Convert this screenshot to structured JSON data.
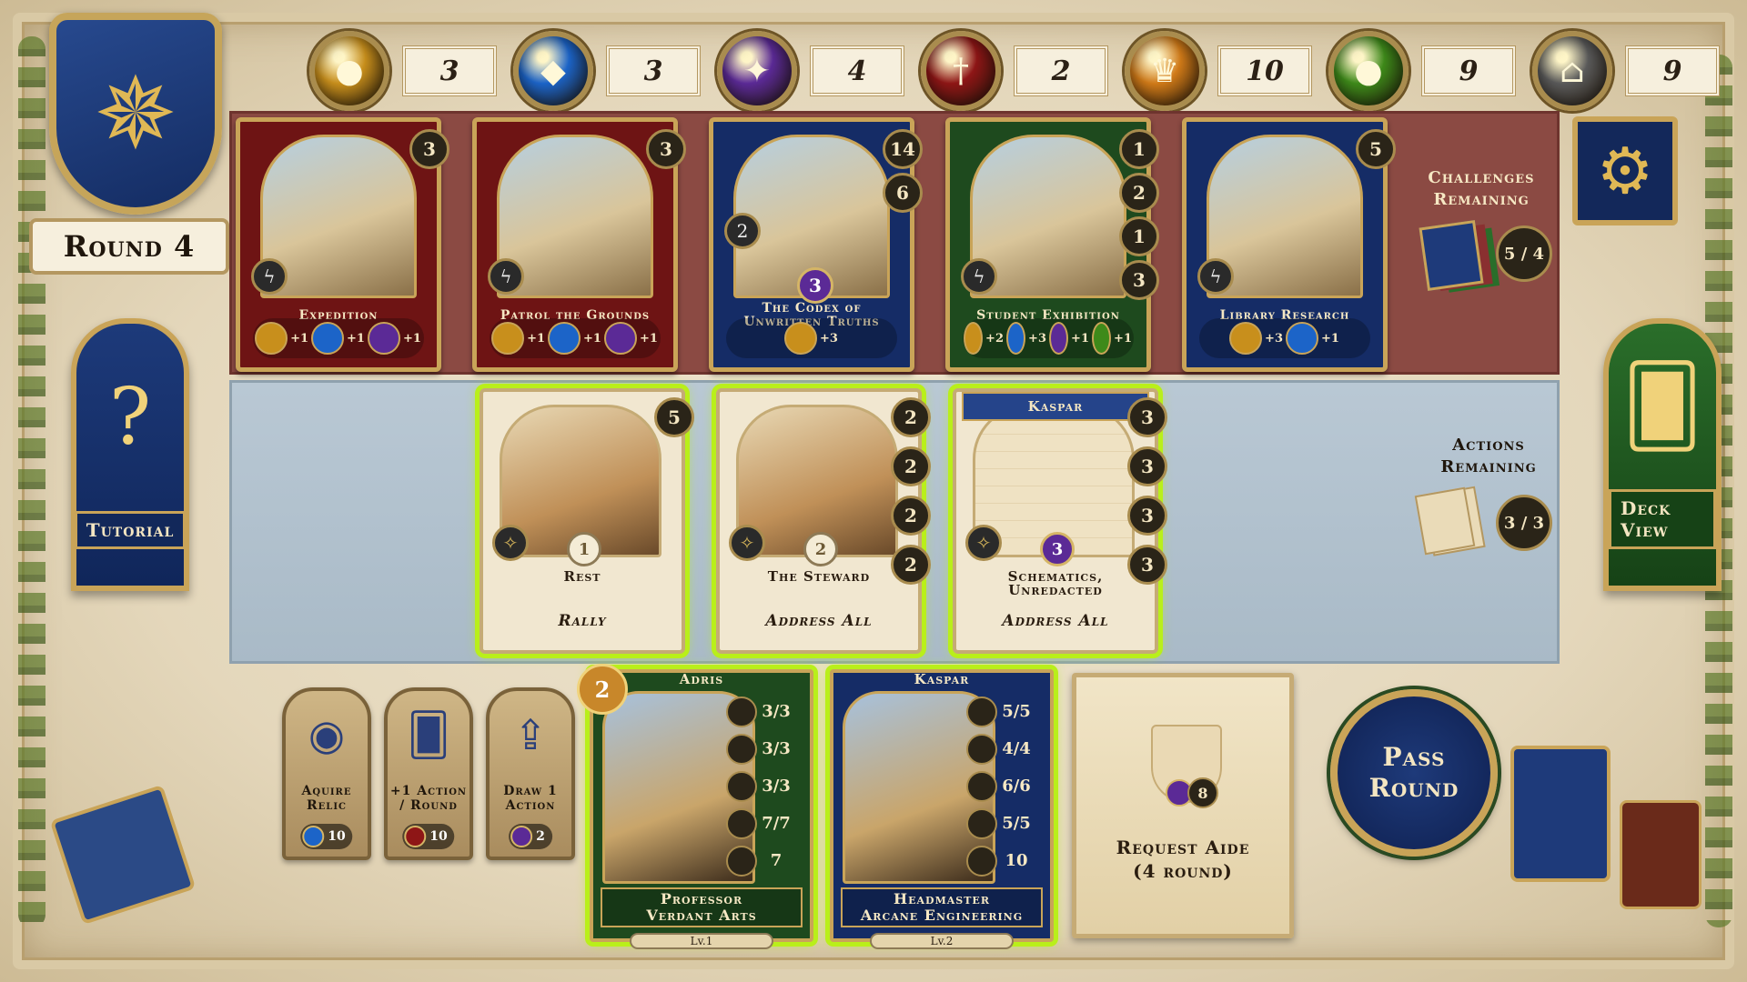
{
  "resources": [
    {
      "icon": "gold-cluster-icon",
      "glyph": "●",
      "color": "#c88f1c",
      "value": "3"
    },
    {
      "icon": "blue-crystal-icon",
      "glyph": "◆",
      "color": "#1c64c8",
      "value": "3"
    },
    {
      "icon": "purple-star-icon",
      "glyph": "✦",
      "color": "#5b2a96",
      "value": "4"
    },
    {
      "icon": "red-sword-icon",
      "glyph": "†",
      "color": "#8e1616",
      "value": "2"
    },
    {
      "icon": "crown-icon",
      "glyph": "♛",
      "color": "#d07a18",
      "value": "10"
    },
    {
      "icon": "green-cluster-icon",
      "glyph": "●",
      "color": "#3e8a1a",
      "value": "9"
    },
    {
      "icon": "building-icon",
      "glyph": "⌂",
      "color": "#5a5a5a",
      "value": "9"
    }
  ],
  "round_label": "Round 4",
  "banners": {
    "tutorial": "Tutorial",
    "deck_view": "Deck View"
  },
  "challenges": {
    "label_line1": "Challenges",
    "label_line2": "Remaining",
    "count": "5 / 4",
    "cards": [
      {
        "title": "Expedition",
        "style": "red",
        "cost": "3",
        "rewards": [
          "+1",
          "+1",
          "+1"
        ]
      },
      {
        "title": "Patrol the Grounds",
        "style": "red",
        "cost": "3",
        "rewards": [
          "+1",
          "+1",
          "+1"
        ]
      },
      {
        "title": "The Codex of Unwritten Truths",
        "style": "blue",
        "costs": [
          "14",
          "6"
        ],
        "badge": "2",
        "mid": "3",
        "rewards": [
          "+3"
        ]
      },
      {
        "title": "Student Exhibition",
        "style": "green",
        "costs": [
          "1",
          "2",
          "1",
          "3"
        ],
        "rewards": [
          "+2",
          "+3",
          "+1",
          "+1"
        ]
      },
      {
        "title": "Library Research",
        "style": "blue",
        "cost": "5",
        "rewards": [
          "+3",
          "+1"
        ]
      }
    ]
  },
  "actions": {
    "label_line1": "Actions",
    "label_line2": "Remaining",
    "count": "3 / 3",
    "cards": [
      {
        "name": "Rest",
        "type": "Rally",
        "num": "1",
        "costs": [
          "5"
        ]
      },
      {
        "name": "The Steward",
        "type": "Address All",
        "num": "2",
        "costs": [
          "2",
          "2",
          "2",
          "2"
        ]
      },
      {
        "name": "Schematics, Unredacted",
        "type": "Address All",
        "num": "3",
        "tag": "Kaspar",
        "costs": [
          "3",
          "3",
          "3",
          "3"
        ]
      }
    ]
  },
  "shop": [
    {
      "label": "Aquire Relic",
      "cost": "10"
    },
    {
      "label": "+1 Action / Round",
      "cost": "10"
    },
    {
      "label": "Draw 1 Action",
      "cost": "2"
    }
  ],
  "aides": [
    {
      "who": "Adris",
      "title_line1": "Professor",
      "title_line2": "Verdant Arts",
      "level": "Lv.1",
      "timer": "2",
      "stats": [
        "3/3",
        "3/3",
        "3/3",
        "7/7",
        "7"
      ]
    },
    {
      "who": "Kaspar",
      "title_line1": "Headmaster",
      "title_line2": "Arcane Engineering",
      "level": "Lv.2",
      "stats": [
        "5/5",
        "4/4",
        "6/6",
        "5/5",
        "10"
      ]
    }
  ],
  "request": {
    "label_line1": "Request Aide",
    "label_line2": "(4 round)",
    "cost": "8"
  },
  "pass": {
    "line1": "Pass",
    "line2": "Round"
  },
  "colors": {
    "selected_glow": "#b9ef1a",
    "gold_trim": "#c9a458"
  }
}
